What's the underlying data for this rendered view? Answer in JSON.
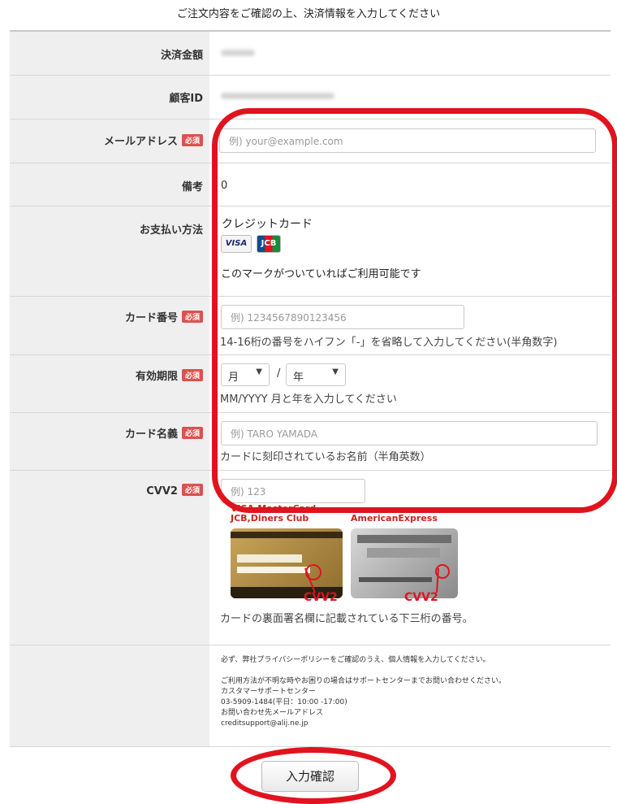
{
  "intro_text": "ご注文内容をご確認の上、決済情報を入力してください",
  "required_label": "必須",
  "amount": {
    "label": "決済金額"
  },
  "customer_id": {
    "label": "顧客ID"
  },
  "email": {
    "label": "メールアドレス",
    "placeholder": "例) your@example.com"
  },
  "notes": {
    "label": "備考",
    "value": "0"
  },
  "payment": {
    "label": "お支払い方法",
    "method": "クレジットカード",
    "brands": [
      "VISA",
      "JCB"
    ],
    "note": "このマークがついていればご利用可能です"
  },
  "card_number": {
    "label": "カード番号",
    "placeholder": "例) 1234567890123456",
    "help": "14-16桁の番号をハイフン「-」を省略して入力してください(半角数字)"
  },
  "expiry": {
    "label": "有効期限",
    "month": "月",
    "separator": "/",
    "year": "年",
    "help": "MM/YYYY 月と年を入力してください"
  },
  "card_name": {
    "label": "カード名義",
    "placeholder": "例) TARO YAMADA",
    "help": "カードに刻印されているお名前（半角英数）"
  },
  "cvv": {
    "label": "CVV2",
    "placeholder": "例) 123",
    "caption_left_1": "VISA,MasterCard",
    "caption_left_2": "JCB,Diners Club",
    "caption_right": "AmericanExpress",
    "pointer_label": "CVV2",
    "help": "カードの裏面署名欄に記載されている下三桁の番号。"
  },
  "privacy": {
    "line1": "必ず、弊社プライバシーポリシーをご確認のうえ、個人情報を入力してください。",
    "line2": "ご利用方法が不明な時やお困りの場合はサポートセンターまでお問い合わせください。",
    "line3": "カスタマーサポートセンター",
    "line4": "03-5909-1484(平日：10:00 -17:00)",
    "line5": "お問い合わせ先メールアドレス",
    "line6": "creditsupport@alij.ne.jp"
  },
  "confirm_button": "入力確認",
  "colors": {
    "highlight": "#e0131f",
    "required_badge": "#d9534f",
    "label_bg": "#efefef"
  }
}
